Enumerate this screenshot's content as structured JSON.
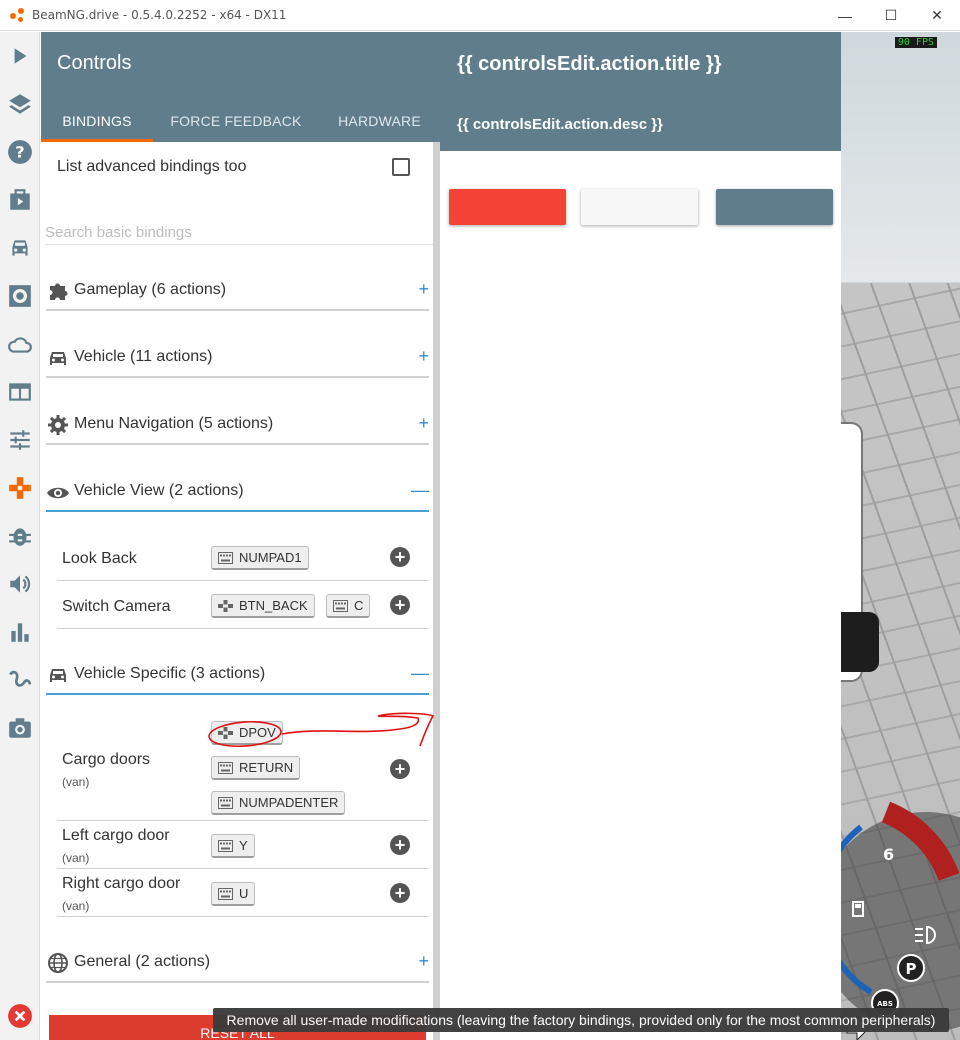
{
  "window": {
    "title": "BeamNG.drive - 0.5.4.0.2252 - x64 - DX11",
    "minimize": "—",
    "maximize": "☐",
    "close": "✕"
  },
  "rail": [
    "play-icon",
    "layers-icon",
    "help-icon",
    "video-icon",
    "car-icon",
    "settings-icon",
    "cloud-icon",
    "dashboard-icon",
    "sliders-icon",
    "gamepad-icon",
    "bug-icon",
    "sound-icon",
    "stats-icon",
    "route-icon",
    "camera-icon",
    "exit-icon"
  ],
  "header": {
    "title": "Controls",
    "tabs": [
      {
        "label": "BINDINGS"
      },
      {
        "label": "FORCE FEEDBACK"
      },
      {
        "label": "HARDWARE"
      }
    ]
  },
  "editor": {
    "title": "{{ controlsEdit.action.title }}",
    "desc": "{{ controlsEdit.action.desc }}",
    "colors": {
      "delete": "#f44336",
      "cancel": "#f7f7f7",
      "apply": "#5f7d8a"
    }
  },
  "list": {
    "advanced_label": "List advanced bindings too",
    "search_placeholder": "Search basic bindings",
    "categories": [
      {
        "label": "Gameplay (6 actions)",
        "toggle": "+"
      },
      {
        "label": "Vehicle (11 actions)",
        "toggle": "+"
      },
      {
        "label": "Menu Navigation (5 actions)",
        "toggle": "+"
      },
      {
        "label": "Vehicle View (2 actions)",
        "toggle": "—"
      },
      {
        "label": "Vehicle Specific (3 actions)",
        "toggle": "—"
      },
      {
        "label": "General (2 actions)",
        "toggle": "+"
      }
    ],
    "vehicle_view_actions": [
      {
        "name": "Look Back",
        "bindings": [
          "NUMPAD1"
        ]
      },
      {
        "name": "Switch Camera",
        "bindings": [
          "BTN_BACK",
          "C"
        ]
      }
    ],
    "vehicle_specific_actions": [
      {
        "name": "Cargo doors",
        "sub": "(van)",
        "bindings": [
          "DPOV",
          "RETURN",
          "NUMPADENTER"
        ]
      },
      {
        "name": "Left cargo door",
        "sub": "(van)",
        "bindings": [
          "Y"
        ]
      },
      {
        "name": "Right cargo door",
        "sub": "(van)",
        "bindings": [
          "U"
        ]
      }
    ],
    "add": "+",
    "reset_label": "RESET ALL"
  },
  "game": {
    "fps": "90 FPS",
    "gear": "6",
    "parking": "P",
    "abs": "ABS"
  },
  "tooltip": "Remove all user-made modifications (leaving the factory bindings, provided only for the most common peripherals)"
}
